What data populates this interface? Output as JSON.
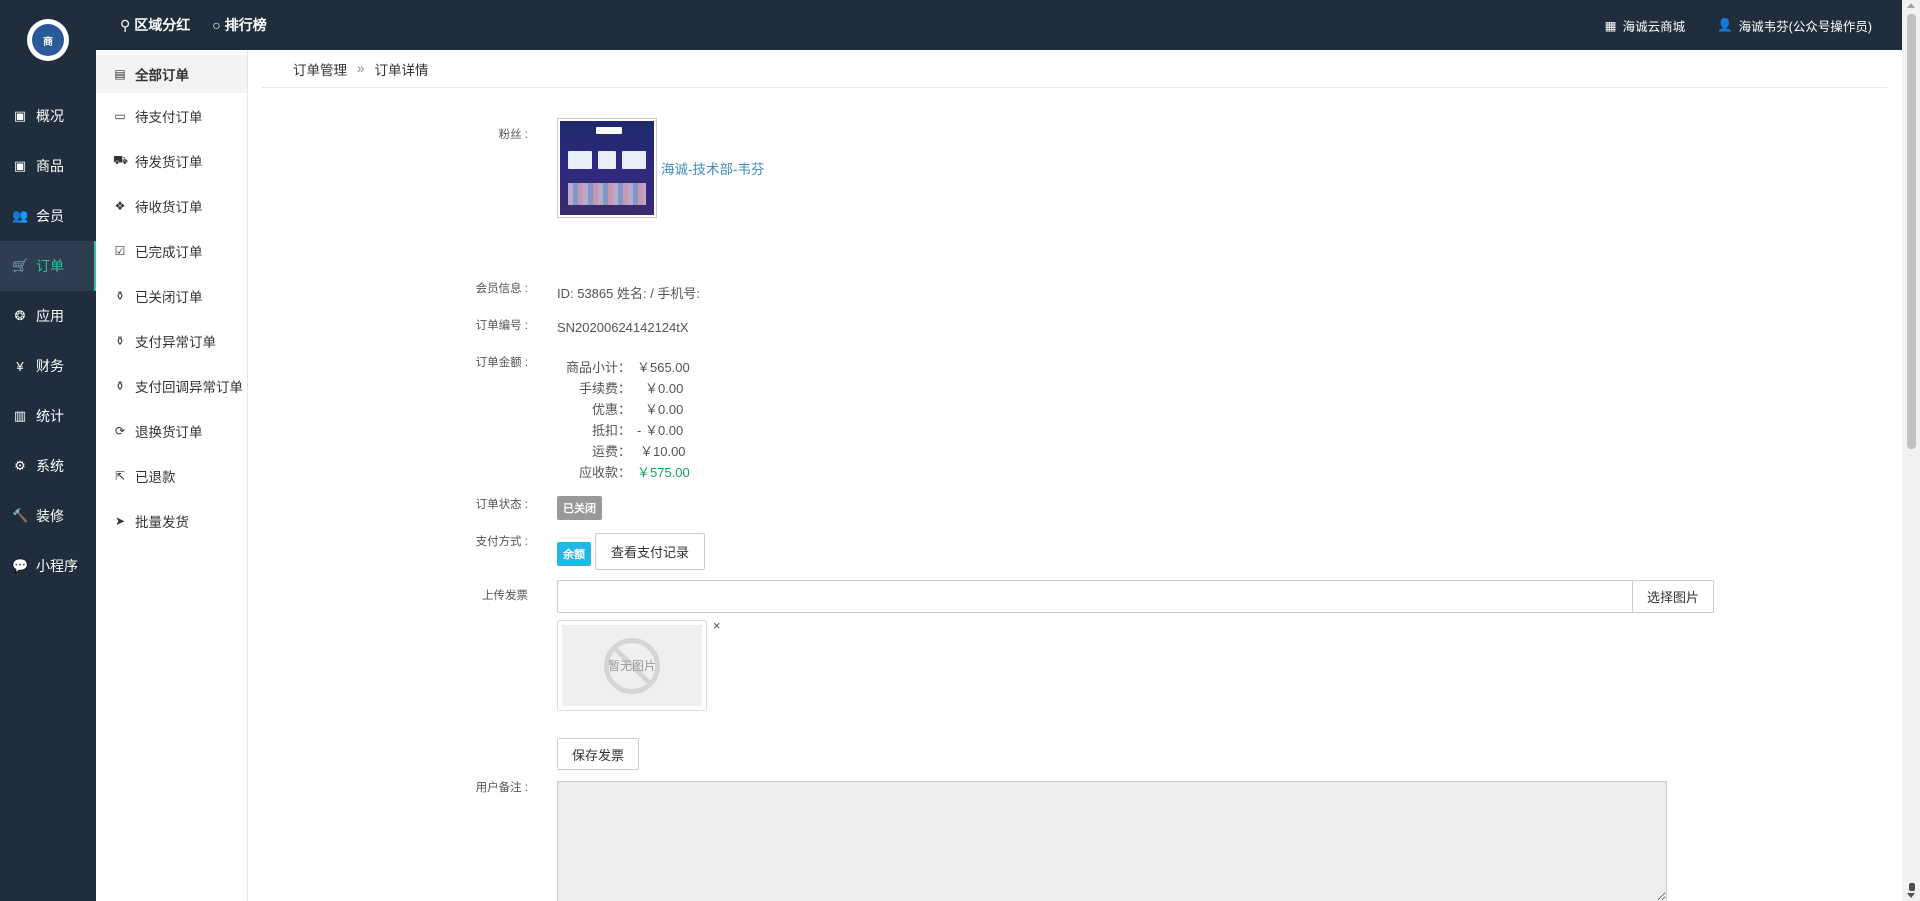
{
  "topbar": {
    "logo_text": "商",
    "nav": [
      {
        "icon": "trophy-icon",
        "glyph": "⚲",
        "label": "区域分红"
      },
      {
        "icon": "circle-icon",
        "glyph": "○",
        "label": "排行榜"
      }
    ],
    "right": [
      {
        "icon": "grid-icon",
        "glyph": "▦",
        "label": "海诚云商城"
      },
      {
        "icon": "user-icon",
        "glyph": "👤",
        "label": "海诚韦芬(公众号操作员)"
      }
    ]
  },
  "sidebar": {
    "items": [
      {
        "glyph": "▣",
        "label": "概况"
      },
      {
        "glyph": "▣",
        "label": "商品"
      },
      {
        "glyph": "👥",
        "label": "会员"
      },
      {
        "glyph": "🛒",
        "label": "订单"
      },
      {
        "glyph": "❂",
        "label": "应用"
      },
      {
        "glyph": "¥",
        "label": "财务"
      },
      {
        "glyph": "▥",
        "label": "统计"
      },
      {
        "glyph": "⚙",
        "label": "系统"
      },
      {
        "glyph": "🔨",
        "label": "装修"
      },
      {
        "glyph": "💬",
        "label": "小程序"
      }
    ],
    "active_index": 3
  },
  "subsidebar": {
    "items": [
      {
        "glyph": "▤",
        "label": "全部订单"
      },
      {
        "glyph": "▭",
        "label": "待支付订单"
      },
      {
        "glyph": "⛟",
        "label": "待发货订单"
      },
      {
        "glyph": "❖",
        "label": "待收货订单"
      },
      {
        "glyph": "☑",
        "label": "已完成订单"
      },
      {
        "glyph": "⚱",
        "label": "已关闭订单"
      },
      {
        "glyph": "⚱",
        "label": "支付异常订单"
      },
      {
        "glyph": "⚱",
        "label": "支付回调异常订单"
      },
      {
        "glyph": "⟳",
        "label": "退换货订单"
      },
      {
        "glyph": "⇱",
        "label": "已退款"
      },
      {
        "glyph": "➤",
        "label": "批量发货"
      }
    ],
    "active_index": 0
  },
  "breadcrumb": {
    "parent": "订单管理",
    "sep": "»",
    "current": "订单详情"
  },
  "detail": {
    "fan_label": "粉丝 :",
    "fan_name": "海诚-技术部-韦芬",
    "member_label": "会员信息 :",
    "member_value": "ID: 53865 姓名: / 手机号:",
    "order_no_label": "订单编号 :",
    "order_no": "SN20200624142124tX",
    "amount_label": "订单金额 :",
    "amounts": [
      {
        "k": "商品小计：",
        "v": "￥565.00"
      },
      {
        "k": "手续费：",
        "v": "￥0.00"
      },
      {
        "k": "优惠：",
        "v": "￥0.00"
      },
      {
        "k": "抵扣：",
        "v": "- ￥0.00"
      },
      {
        "k": "运费：",
        "v": "￥10.00"
      },
      {
        "k": "应收款：",
        "v": "￥575.00"
      }
    ],
    "status_label": "订单状态 :",
    "status_value": "已关闭",
    "pay_label": "支付方式 :",
    "pay_value": "余额",
    "pay_record_button": "查看支付记录",
    "invoice_label": "上传发票",
    "invoice_input_value": "",
    "choose_image_button": "选择图片",
    "no_image_text": "暂无图片",
    "remove_glyph": "×",
    "save_invoice_button": "保存发票",
    "remark_label": "用户备注 :",
    "remark_value": ""
  },
  "colors": {
    "dark_bg": "#1f2d3d",
    "accent": "#2bc29e",
    "link": "#3c8dbc",
    "green": "#18a15f",
    "badge_gray": "#999999",
    "badge_cyan": "#23b7e5"
  }
}
